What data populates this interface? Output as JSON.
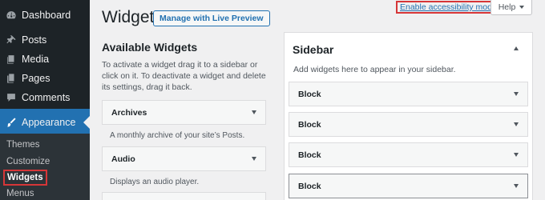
{
  "sidebar": {
    "items": [
      {
        "label": "Dashboard",
        "icon": "dashboard-icon"
      },
      {
        "label": "Posts",
        "icon": "pin-icon"
      },
      {
        "label": "Media",
        "icon": "media-icon"
      },
      {
        "label": "Pages",
        "icon": "pages-icon"
      },
      {
        "label": "Comments",
        "icon": "comments-icon"
      },
      {
        "label": "Appearance",
        "icon": "brush-icon",
        "current": true
      }
    ],
    "submenu": [
      "Themes",
      "Customize",
      "Widgets",
      "Menus"
    ],
    "submenu_current": "Widgets"
  },
  "header": {
    "title": "Widgets",
    "live_preview_label": "Manage with Live Preview",
    "accessibility_link": "Enable accessibility mode",
    "help_label": "Help"
  },
  "available": {
    "heading": "Available Widgets",
    "description": "To activate a widget drag it to a sidebar or click on it. To deactivate a widget and delete its settings, drag it back.",
    "widgets": [
      {
        "title": "Archives",
        "description": "A monthly archive of your site’s Posts."
      },
      {
        "title": "Audio",
        "description": "Displays an audio player."
      }
    ]
  },
  "widget_area": {
    "title": "Sidebar",
    "description": "Add widgets here to appear in your sidebar.",
    "blocks": [
      "Block",
      "Block",
      "Block",
      "Block"
    ]
  },
  "colors": {
    "admin_bg": "#1d2327",
    "submenu_bg": "#2c3338",
    "accent": "#2271b1",
    "highlight": "#d63638"
  }
}
